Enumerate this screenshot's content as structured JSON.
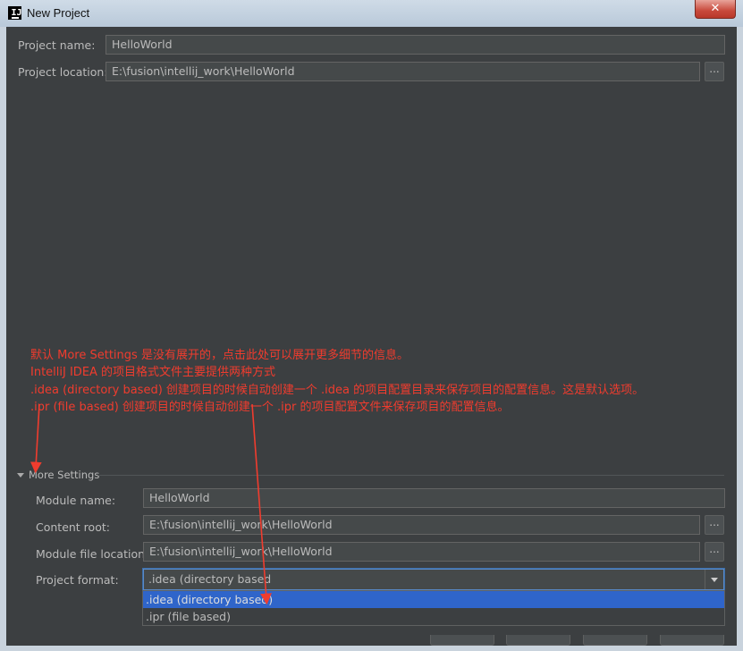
{
  "window": {
    "title": "New Project",
    "close_glyph": "✕"
  },
  "form": {
    "project_name_label": "Project name:",
    "project_name_value": "HelloWorld",
    "project_location_label": "Project location:",
    "project_location_value": "E:\\fusion\\intellij_work\\HelloWorld",
    "browse_label": "..."
  },
  "annotation": {
    "line1": "默认 More Settings 是没有展开的，点击此处可以展开更多细节的信息。",
    "line2": "IntelliJ IDEA 的项目格式文件主要提供两种方式",
    "line3": ".idea (directory based) 创建项目的时候自动创建一个 .idea 的项目配置目录来保存项目的配置信息。这是默认选项。",
    "line4": ".ipr (file based) 创建项目的时候自动创建一个 .ipr 的项目配置文件来保存项目的配置信息。",
    "color": "#f03c2e"
  },
  "more_settings": {
    "toggle_label": "More Settings",
    "module_name_label": "Module name:",
    "module_name_value": "HelloWorld",
    "content_root_label": "Content root:",
    "content_root_value": "E:\\fusion\\intellij_work\\HelloWorld",
    "module_file_location_label": "Module file location:",
    "module_file_location_value": "E:\\fusion\\intellij_work\\HelloWorld",
    "project_format_label": "Project format:",
    "project_format_value": ".idea (directory based",
    "project_format_options": [
      ".idea (directory based)",
      ".ipr (file based)"
    ]
  },
  "colors": {
    "background": "#3c3f41",
    "field": "#45494a",
    "selection": "#2f65ca",
    "focus": "#5a8ac8"
  }
}
